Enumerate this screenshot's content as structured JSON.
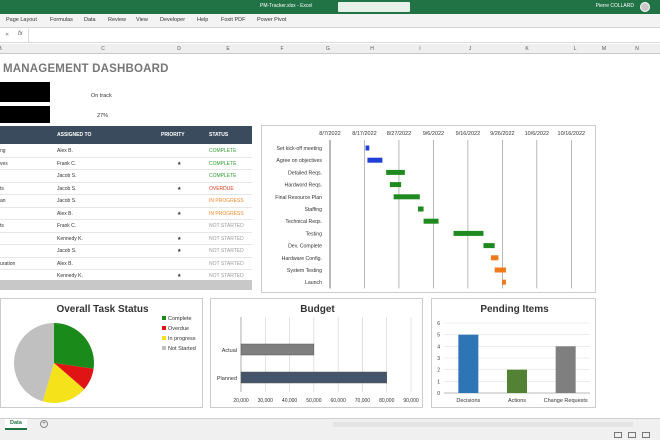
{
  "window": {
    "doc_title": "PM-Tracker.xlsx - Excel",
    "user": "Pierre COLLARD"
  },
  "ribbon": {
    "tabs": [
      "Page Layout",
      "Formulas",
      "Data",
      "Review",
      "View",
      "Developer",
      "Help",
      "Foxit PDF",
      "Power Pivot"
    ]
  },
  "formula_bar": {
    "fx": "fx",
    "value": ""
  },
  "columns": [
    "B",
    "C",
    "D",
    "E",
    "F",
    "G",
    "H",
    "I",
    "J",
    "K",
    "L",
    "M",
    "N"
  ],
  "dashboard": {
    "title": "MANAGEMENT DASHBOARD",
    "status_text": "On track",
    "percent_text": "27%"
  },
  "table": {
    "headers": [
      "",
      "ASSIGNED TO",
      "PRIORITY",
      "STATUS"
    ],
    "rows": [
      {
        "task": "ng",
        "assigned": "Alex B.",
        "priority": "",
        "status": "COMPLETE",
        "status_color": "#2e9e2e"
      },
      {
        "task": "ves",
        "assigned": "Frank C.",
        "priority": "★",
        "status": "COMPLETE",
        "status_color": "#2e9e2e"
      },
      {
        "task": "",
        "assigned": "Jacob S.",
        "priority": "",
        "status": "COMPLETE",
        "status_color": "#2e9e2e"
      },
      {
        "task": "ts",
        "assigned": "Jacob S.",
        "priority": "★",
        "status": "OVERDUE",
        "status_color": "#e03a1e"
      },
      {
        "task": "an",
        "assigned": "Jacob S.",
        "priority": "",
        "status": "IN PROGRESS",
        "status_color": "#f08a2a"
      },
      {
        "task": "",
        "assigned": "Alex B.",
        "priority": "★",
        "status": "IN PROGRESS",
        "status_color": "#f08a2a"
      },
      {
        "task": "ts",
        "assigned": "Frank C.",
        "priority": "",
        "status": "NOT STARTED",
        "status_color": "#9a9a9a"
      },
      {
        "task": "",
        "assigned": "Kennedy K.",
        "priority": "★",
        "status": "NOT STARTED",
        "status_color": "#9a9a9a"
      },
      {
        "task": "",
        "assigned": "Jacob S.",
        "priority": "★",
        "status": "NOT STARTED",
        "status_color": "#9a9a9a"
      },
      {
        "task": "uration",
        "assigned": "Alex B.",
        "priority": "",
        "status": "NOT STARTED",
        "status_color": "#9a9a9a"
      },
      {
        "task": "",
        "assigned": "Kennedy K.",
        "priority": "★",
        "status": "NOT STARTED",
        "status_color": "#9a9a9a"
      }
    ]
  },
  "gantt": {
    "dates": [
      "8/7/2022",
      "8/17/2022",
      "8/27/2022",
      "9/6/2022",
      "9/16/2022",
      "9/26/2022",
      "10/6/2022",
      "10/16/2022"
    ],
    "tasks": [
      {
        "label": "Set kick-off meeting",
        "start": 9.5,
        "dur": 1,
        "color": "#1f3fd6"
      },
      {
        "label": "Agree on objectives",
        "start": 10,
        "dur": 4,
        "color": "#1f3fd6"
      },
      {
        "label": "Detailed Reqs.",
        "start": 15,
        "dur": 5,
        "color": "#1f8a1f"
      },
      {
        "label": "Hardword Reqs.",
        "start": 16,
        "dur": 3,
        "color": "#1f8a1f"
      },
      {
        "label": "Final Resource Plan",
        "start": 17,
        "dur": 7,
        "color": "#1f8a1f"
      },
      {
        "label": "Staffing",
        "start": 23.5,
        "dur": 1.5,
        "color": "#1f8a1f"
      },
      {
        "label": "Technical Reqs.",
        "start": 25,
        "dur": 4,
        "color": "#1f8a1f"
      },
      {
        "label": "Testing",
        "start": 33,
        "dur": 8,
        "color": "#1f8a1f"
      },
      {
        "label": "Dev. Complete",
        "start": 41,
        "dur": 3,
        "color": "#1f8a1f"
      },
      {
        "label": "Hardware Config.",
        "start": 43,
        "dur": 2,
        "color": "#f07a1a"
      },
      {
        "label": "System Testing",
        "start": 44,
        "dur": 3,
        "color": "#f07a1a"
      },
      {
        "label": "Launch",
        "start": 46,
        "dur": 1,
        "color": "#f07a1a"
      }
    ],
    "total_days": 70
  },
  "chart_data": [
    {
      "type": "pie",
      "title": "Overall Task Status",
      "categories": [
        "Complete",
        "Overdue",
        "In progress",
        "Not Started"
      ],
      "values": [
        3,
        1,
        2,
        5
      ],
      "colors": [
        "#1a8a1a",
        "#e01414",
        "#f5e21a",
        "#c0c0c0"
      ],
      "legend": "right"
    },
    {
      "type": "bar",
      "orientation": "horizontal",
      "title": "Budget",
      "categories": [
        "Actual",
        "Planned"
      ],
      "values": [
        50000,
        80000
      ],
      "colors": [
        "#7f7f7f",
        "#44546a"
      ],
      "xlim": [
        20000,
        90000
      ],
      "ticks": [
        "20,000",
        "30,000",
        "40,000",
        "50,000",
        "60,000",
        "70,000",
        "80,000",
        "90,000"
      ]
    },
    {
      "type": "bar",
      "title": "Pending Items",
      "categories": [
        "Decisions",
        "Actions",
        "Change Requests"
      ],
      "values": [
        5,
        2,
        4
      ],
      "colors": [
        "#2e75b6",
        "#548235",
        "#7f7f7f"
      ],
      "ylim": [
        0,
        6
      ],
      "ticks": [
        "0",
        "1",
        "2",
        "3",
        "4",
        "5",
        "6"
      ]
    }
  ],
  "sheet_tabs": {
    "active": "Data",
    "add": "+"
  }
}
